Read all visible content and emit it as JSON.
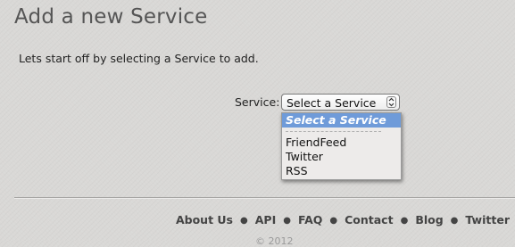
{
  "page": {
    "title": "Add a new Service",
    "intro": "Lets start off by selecting a Service to add."
  },
  "form": {
    "service_label": "Service:",
    "selected_value": "Select a Service",
    "options": [
      "Select a Service",
      "FriendFeed",
      "Twitter",
      "RSS"
    ]
  },
  "footer": {
    "links": [
      "About Us",
      "API",
      "FAQ",
      "Contact",
      "Blog",
      "Twitter"
    ],
    "separator": "●",
    "copyright": "© 2012"
  },
  "colors": {
    "background": "#d9d8d6",
    "highlight": "#6f9bd9",
    "title": "#555555"
  },
  "icons": {
    "select_arrows": "up-down-chevron-icon"
  }
}
